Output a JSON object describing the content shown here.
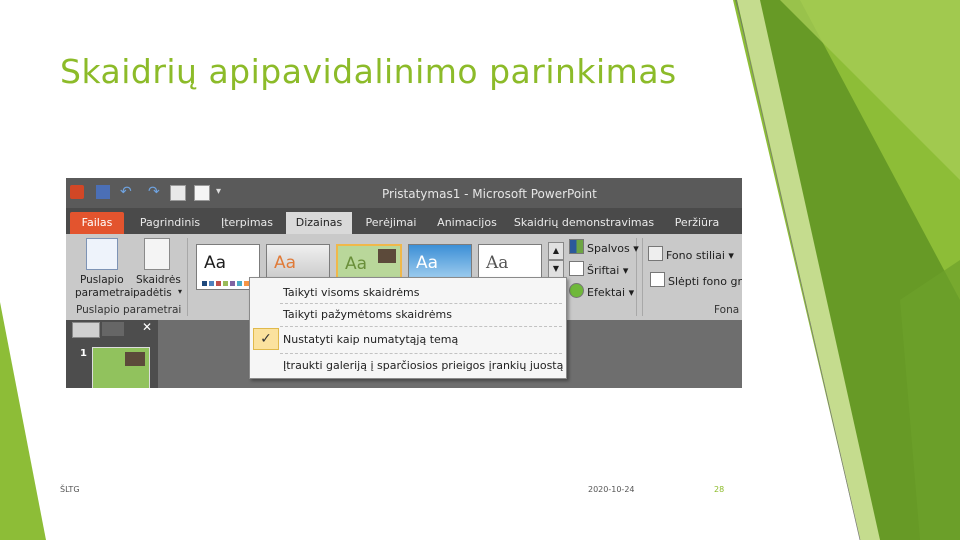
{
  "colors": {
    "title": "#8cbb29",
    "green_light": "#c5dc8e",
    "green_mid": "#8dbd37",
    "green_dark": "#5b8f22",
    "file_tab": "#e3542e"
  },
  "slide": {
    "title": "Skaidrių apipavidalinimo parinkimas",
    "footer_left": "ŠLTG",
    "footer_date": "2020-10-24",
    "footer_page": "28"
  },
  "window": {
    "title": "Pristatymas1 - Microsoft PowerPoint",
    "qat_icons": [
      "powerpoint-icon",
      "save-icon",
      "undo-icon",
      "redo-icon",
      "new-slide-icon",
      "open-icon",
      "customize-icon"
    ]
  },
  "tabs": [
    {
      "label": "Failas"
    },
    {
      "label": "Pagrindinis"
    },
    {
      "label": "Įterpimas"
    },
    {
      "label": "Dizainas"
    },
    {
      "label": "Perėjimai"
    },
    {
      "label": "Animacijos"
    },
    {
      "label": "Skaidrių demonstravimas"
    },
    {
      "label": "Peržiūra"
    }
  ],
  "active_tab": "Dizainas",
  "ribbon": {
    "page_setup": "Puslapio parametrai",
    "page_setup_line1": "Puslapio",
    "page_setup_line2": "parametrai",
    "orientation_line1": "Skaidrės",
    "orientation_line2": "padėtis",
    "group_label": "Puslapio parametrai",
    "themes": [
      {
        "sample": "Aa"
      },
      {
        "sample": "Aa"
      },
      {
        "sample": "Aa"
      },
      {
        "sample": "Aa"
      },
      {
        "sample": "Aa"
      }
    ],
    "colors_cmd": "Spalvos",
    "fonts_cmd": "Šriftai",
    "effects_cmd": "Efektai",
    "background_styles": "Fono stiliai",
    "hide_background": "Slėpti fono gra",
    "background_group": "Fona"
  },
  "context_menu": {
    "items": [
      "Taikyti visoms skaidrėms",
      "Taikyti pažymėtoms skaidrėms",
      "Nustatyti kaip numatytąją temą",
      "Įtraukti galeriją į sparčiosios prieigos įrankių juostą"
    ],
    "checked_item_index": 2
  },
  "slides_panel": {
    "slide_number": "1"
  }
}
